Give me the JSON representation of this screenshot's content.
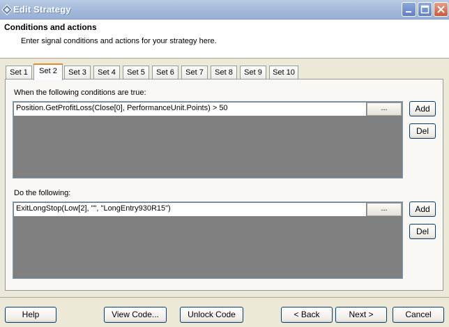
{
  "window": {
    "title": "Edit Strategy",
    "controls": {
      "minimize_icon": "minimize-icon",
      "maximize_icon": "maximize-icon",
      "close_icon": "close-icon"
    }
  },
  "header": {
    "title": "Conditions and actions",
    "subtitle": "Enter signal conditions and actions for your strategy here."
  },
  "tabs": [
    {
      "label": "Set 1"
    },
    {
      "label": "Set 2",
      "active": true
    },
    {
      "label": "Set 3"
    },
    {
      "label": "Set 4"
    },
    {
      "label": "Set 5"
    },
    {
      "label": "Set 6"
    },
    {
      "label": "Set 7"
    },
    {
      "label": "Set 8"
    },
    {
      "label": "Set 9"
    },
    {
      "label": "Set 10"
    }
  ],
  "conditions": {
    "label": "When the following conditions are true:",
    "items": [
      "Position.GetProfitLoss(Close[0], PerformanceUnit.Points) > 50"
    ],
    "ellipsis_label": "...",
    "add_label": "Add",
    "del_label": "Del"
  },
  "actions": {
    "label": "Do the following:",
    "items": [
      "ExitLongStop(Low[2], \"\", \"LongEntry930R15\")"
    ],
    "ellipsis_label": "...",
    "add_label": "Add",
    "del_label": "Del"
  },
  "footer": {
    "help_label": "Help",
    "view_code_label": "View Code...",
    "unlock_code_label": "Unlock Code",
    "back_label": "< Back",
    "next_label": "Next >",
    "cancel_label": "Cancel"
  },
  "colors": {
    "accent_tab": "#e68b2c",
    "list_background": "#808080",
    "titlebar": "#a7bcdc"
  }
}
